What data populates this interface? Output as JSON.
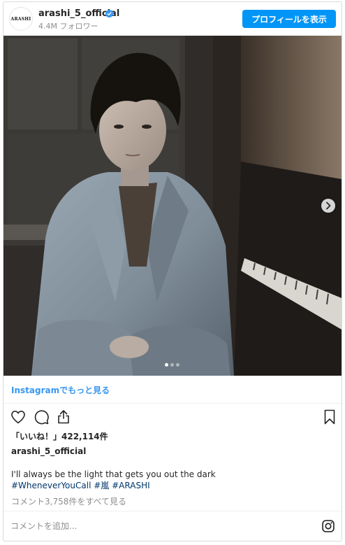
{
  "header": {
    "avatar_text": "ARASHI",
    "username": "arashi_5_official",
    "followers": "4.4M フォロワー",
    "profile_button": "プロフィールを表示"
  },
  "post": {
    "slide_count": 3,
    "active_slide": 1
  },
  "view_more": "Instagramでもっと見る",
  "likes": "「いいね！」422,114件",
  "author": "arashi_5_official",
  "caption": "I'll always be the light that gets you out the dark",
  "hashtags": [
    "#WheneverYouCall",
    "#嵐",
    "#ARASHI"
  ],
  "comments_link": "コメント3,758件をすべて見る",
  "comment_placeholder": "コメントを追加...",
  "colors": {
    "accent": "#0095f6",
    "link": "#3897f0",
    "hashtag": "#00376b",
    "verified": "#3897f0",
    "muted": "#8e8e8e"
  },
  "icons": [
    "verified-icon",
    "chevron-right-icon",
    "heart-icon",
    "comment-icon",
    "share-icon",
    "bookmark-icon",
    "instagram-icon"
  ]
}
